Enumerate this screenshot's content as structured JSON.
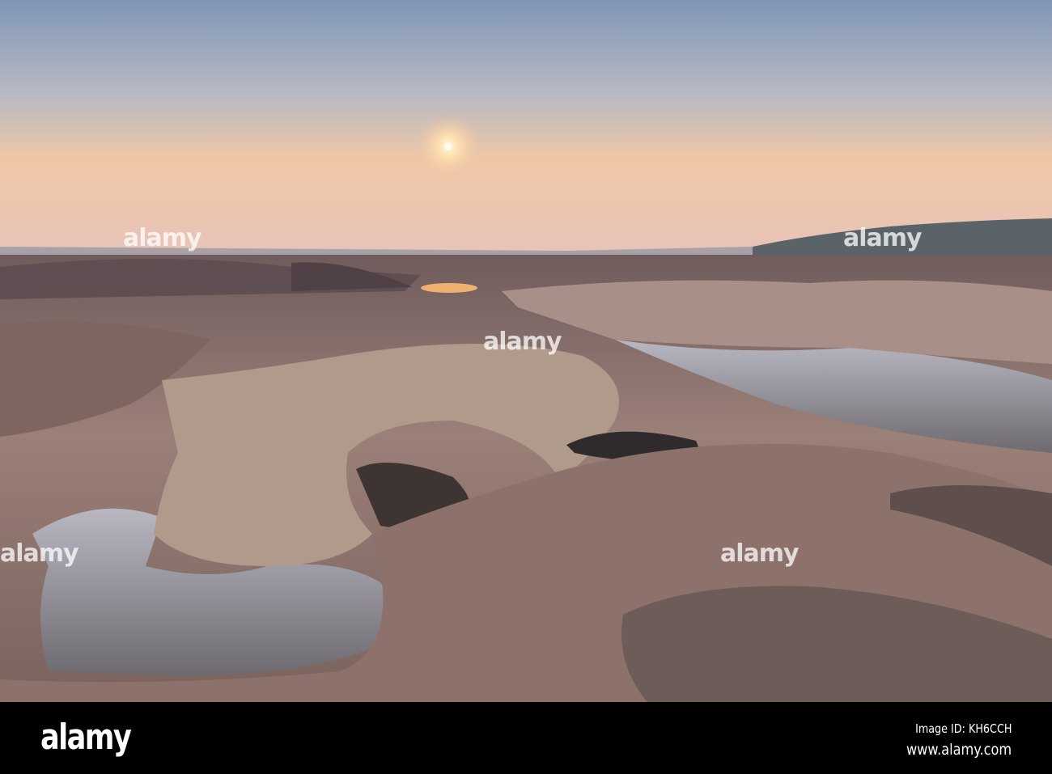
{
  "photo": {
    "description_colors": {
      "sky_top": "#8fa3bd",
      "sky_glow": "#f3c6a2",
      "rock": "#8a7268",
      "water": "#9aa3b5"
    }
  },
  "watermark": {
    "logo": "alamy"
  },
  "footer": {
    "logo": "alamy",
    "image_id": "Image ID: KH6CCH",
    "website": "www.alamy.com"
  }
}
